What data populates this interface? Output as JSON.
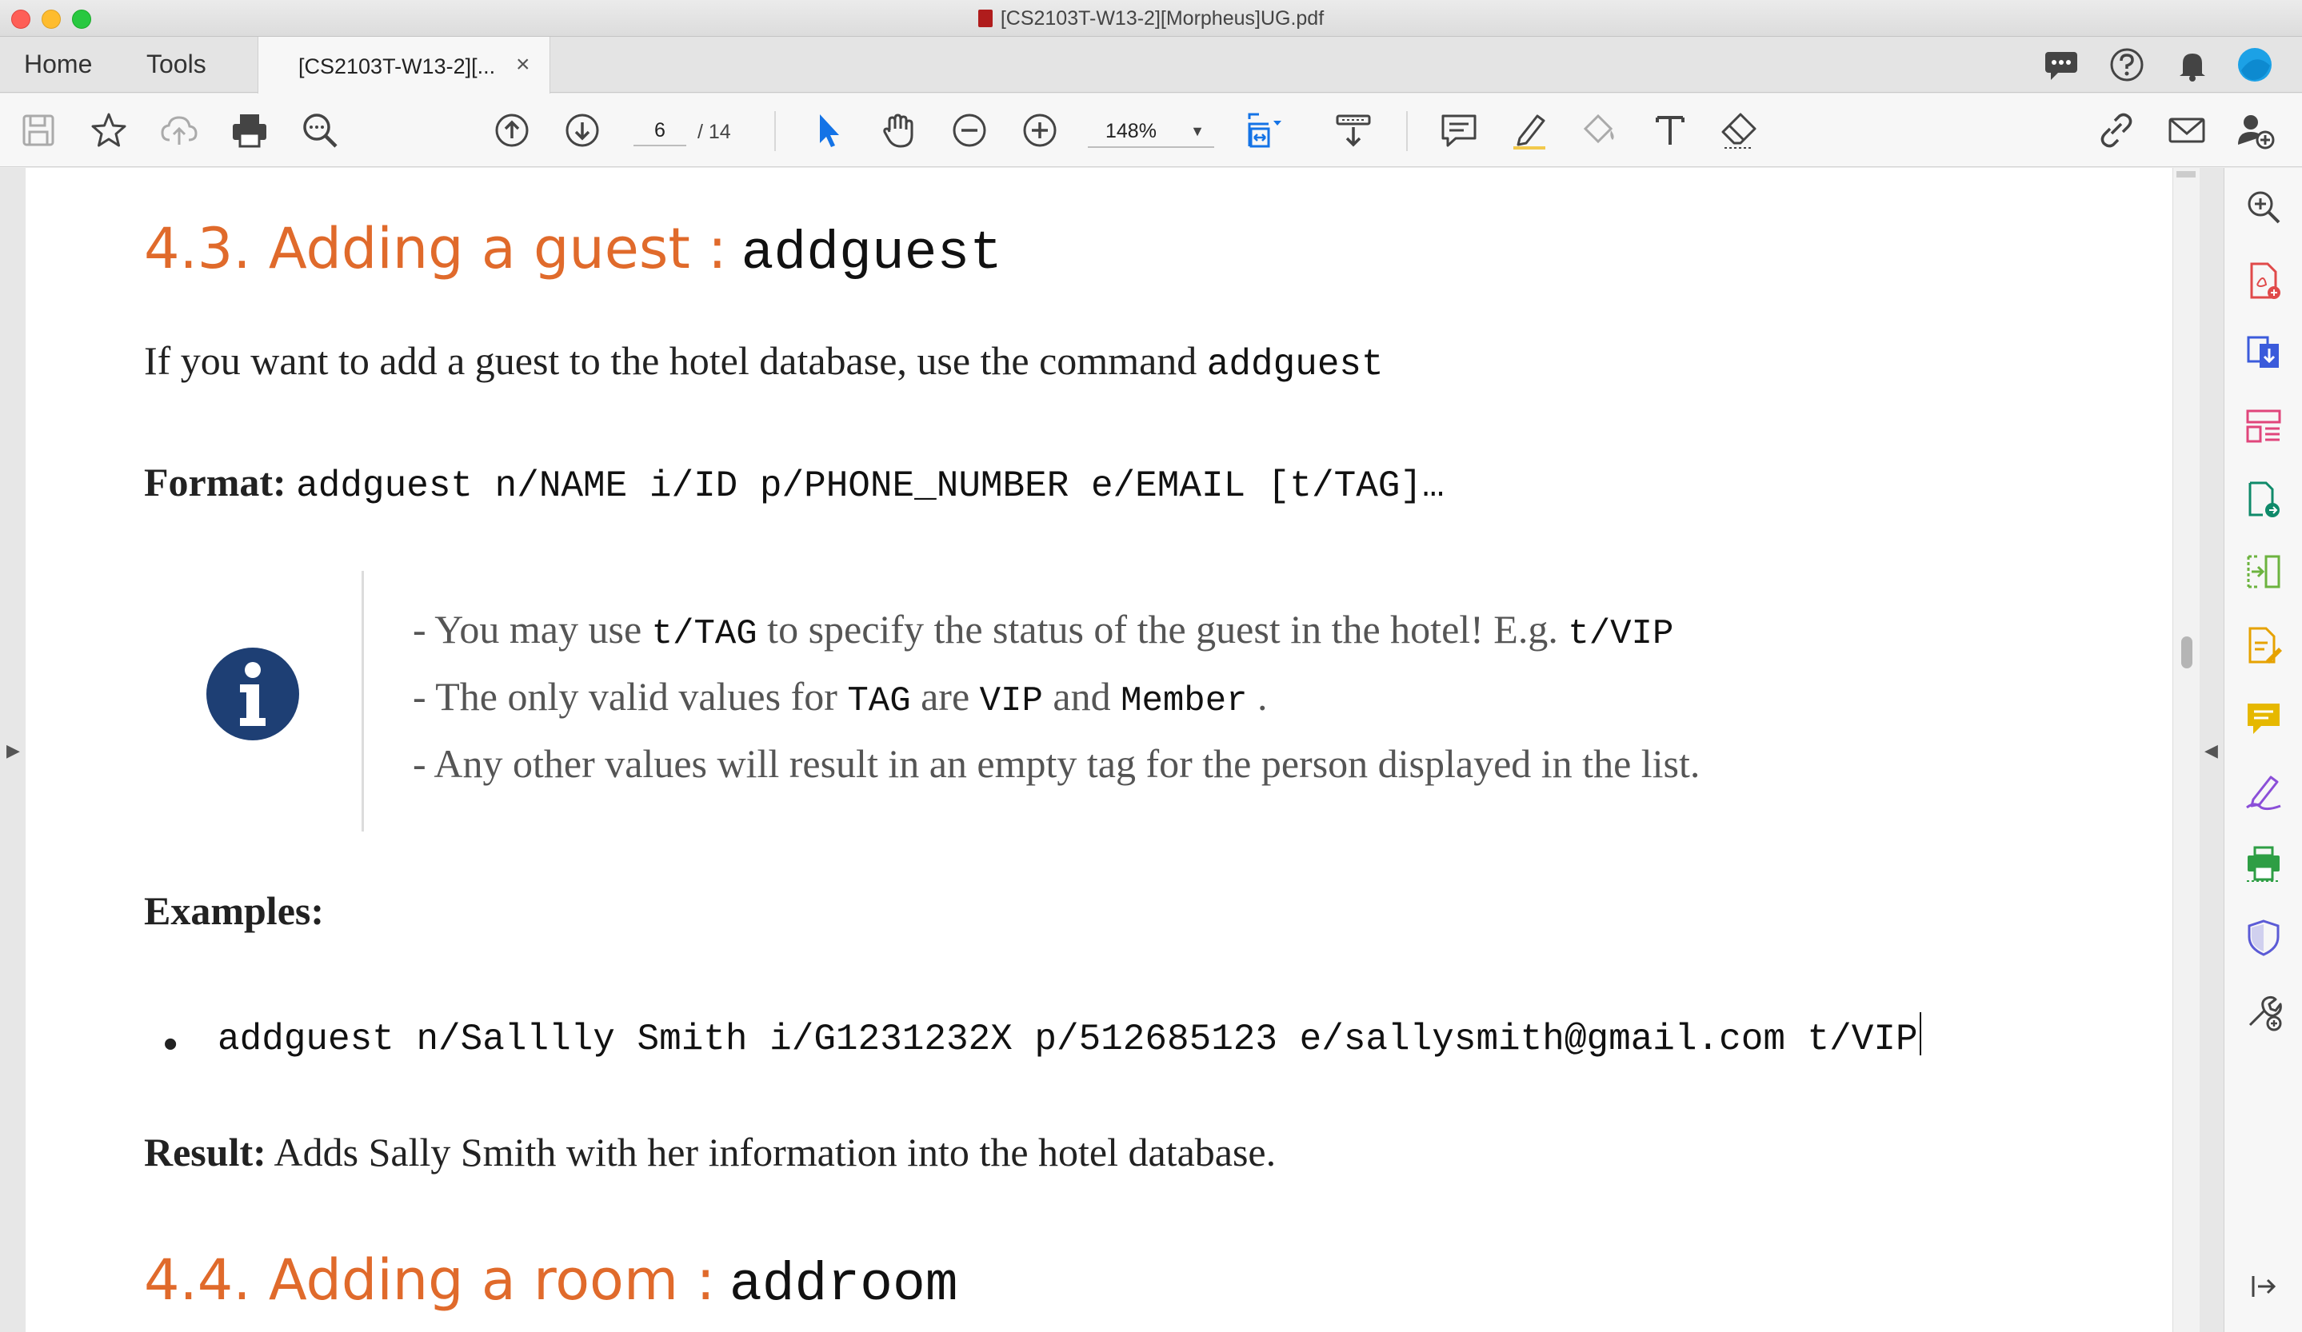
{
  "window": {
    "title": "[CS2103T-W13-2][Morpheus]UG.pdf"
  },
  "tabs": {
    "home": "Home",
    "tools": "Tools",
    "document": "[CS2103T-W13-2][...",
    "close": "×"
  },
  "toolbar": {
    "current_page": "6",
    "total_pages": "/ 14",
    "zoom": "148%"
  },
  "document": {
    "section1": {
      "title": "4.3. Adding a guest :",
      "command": "addguest",
      "intro": "If you want to add a guest to the hotel database, use the command",
      "intro_cmd": "addguest",
      "format_label": "Format:",
      "format_value": "addguest n/NAME i/ID p/PHONE_NUMBER e/EMAIL [t/TAG]…",
      "note": {
        "line1_a": "- You may use",
        "line1_code1": "t/TAG",
        "line1_b": "to specify the status of the guest in the hotel! E.g.",
        "line1_code2": "t/VIP",
        "line2_a": "- The only valid values for",
        "line2_code1": "TAG",
        "line2_b": "are",
        "line2_code2": "VIP",
        "line2_c": "and",
        "line2_code3": "Member",
        "line2_d": ".",
        "line3": "- Any other values will result in an empty tag for the person displayed in the list."
      },
      "examples_label": "Examples:",
      "example": "addguest n/Salllly Smith i/G1231232X p/512685123 e/sallysmith@gmail.com t/VIP",
      "result_label": "Result:",
      "result_text": "Adds Sally Smith with her information into the hotel database."
    },
    "section2": {
      "title": "4.4. Adding a room :",
      "command": "addroom"
    }
  },
  "colors": {
    "heading": "#e06a2b",
    "info_icon": "#1e3f74",
    "accent_blue": "#1473e6"
  }
}
